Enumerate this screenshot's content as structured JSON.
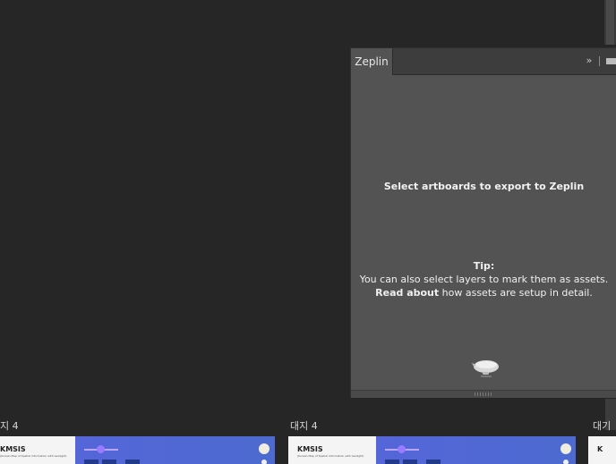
{
  "panel": {
    "tab_label": "Zeplin",
    "collapse_icon": "»",
    "headline": "Select artboards to export to Zeplin",
    "tip_label": "Tip:",
    "tip_text": "You can also select layers to mark them as assets.",
    "read_about": "Read about",
    "read_about_rest": " how assets are setup in detail."
  },
  "artboards": [
    {
      "label": "지 4",
      "title": "KMSIS",
      "subtitle": "(Korean Map of Spatial Information with Geolight)"
    },
    {
      "label": "대지 4",
      "title": "KMSIS",
      "subtitle": "(Korean Map of Spatial Information with Geolight)"
    },
    {
      "label": "대기",
      "title": "K"
    }
  ],
  "colors": {
    "canvas_bg": "#262626",
    "panel_bg": "#535353",
    "artboard_blue": "#4a5fcf"
  }
}
